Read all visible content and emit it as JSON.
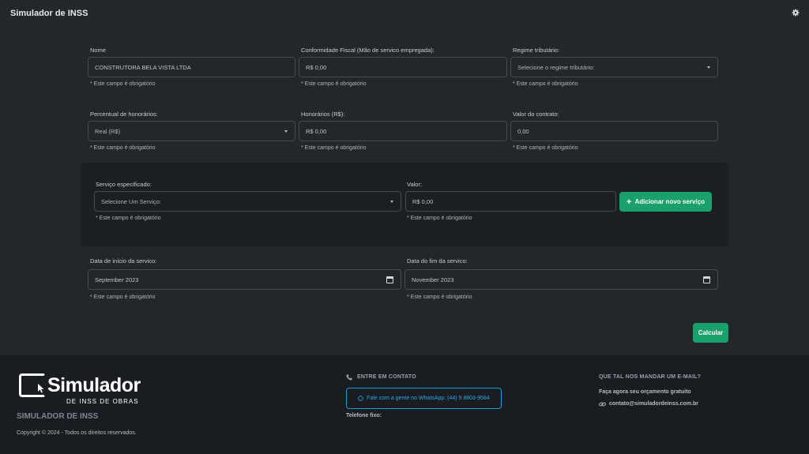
{
  "app": {
    "title": "Simulador de INSS"
  },
  "form": {
    "nome": {
      "label": "Nome",
      "value": "CONSTRUTORA BELA VISTA LTDA"
    },
    "conformidade": {
      "label": "Conformidade Fiscal (Mão de servico empregada):",
      "value": "R$ 0,00"
    },
    "regime": {
      "label": "Regime tributário:",
      "value": "Selecione o regime tributário:"
    },
    "percentual": {
      "label": "Percentual de honorários:",
      "value": "Real (R$)"
    },
    "honorarios": {
      "label": "Honorários (R$):",
      "value": "R$ 0,00"
    },
    "valor_contrato": {
      "label": "Valor do contrato:",
      "value": "0,00"
    },
    "servico": {
      "label": "Serviço especificado:",
      "value": "Selecione Um Serviço:"
    },
    "valor": {
      "label": "Valor:",
      "value": "R$ 0,00"
    },
    "data_inicio": {
      "label": "Data de início da servico:",
      "value": "September 2023"
    },
    "data_fim": {
      "label": "Data do fim da servico:",
      "value": "November 2023"
    },
    "required_note": "* Este campo é obrigatório",
    "add_service_label": "Adicionar novo serviço",
    "add_service_icon": "+",
    "calculate_label": "Calcular"
  },
  "footer": {
    "logo_main": "Simulador",
    "logo_sub": "DE INSS DE OBRAS",
    "brand_name": "SIMULADOR DE INSS",
    "copyright": "Copyright © 2024 - Todos os direitos reservados.",
    "contact_heading": "ENTRE EM CONTATO",
    "whatsapp_label": "Fale com a gente no WhatsApp: (44) 9 8803-9584",
    "phone_label": "Telefone fixo:",
    "email_heading": "QUE TAL NOS MANDAR UM E-MAIL?",
    "email_text": "Faça agora seu orçamento gratuito",
    "email_address": "contato@simuladordeinss.com.br"
  },
  "colors": {
    "background": "#23272b",
    "panel": "#1b1f23",
    "footer": "#191c20",
    "accent_green": "#1aa06a",
    "whatsapp_blue": "#2aa8e6"
  },
  "icons": [
    "gear-icon",
    "chevron-down-icon",
    "calendar-icon",
    "plus-icon",
    "phone-icon",
    "whatsapp-icon",
    "link-icon",
    "cursor-icon"
  ]
}
